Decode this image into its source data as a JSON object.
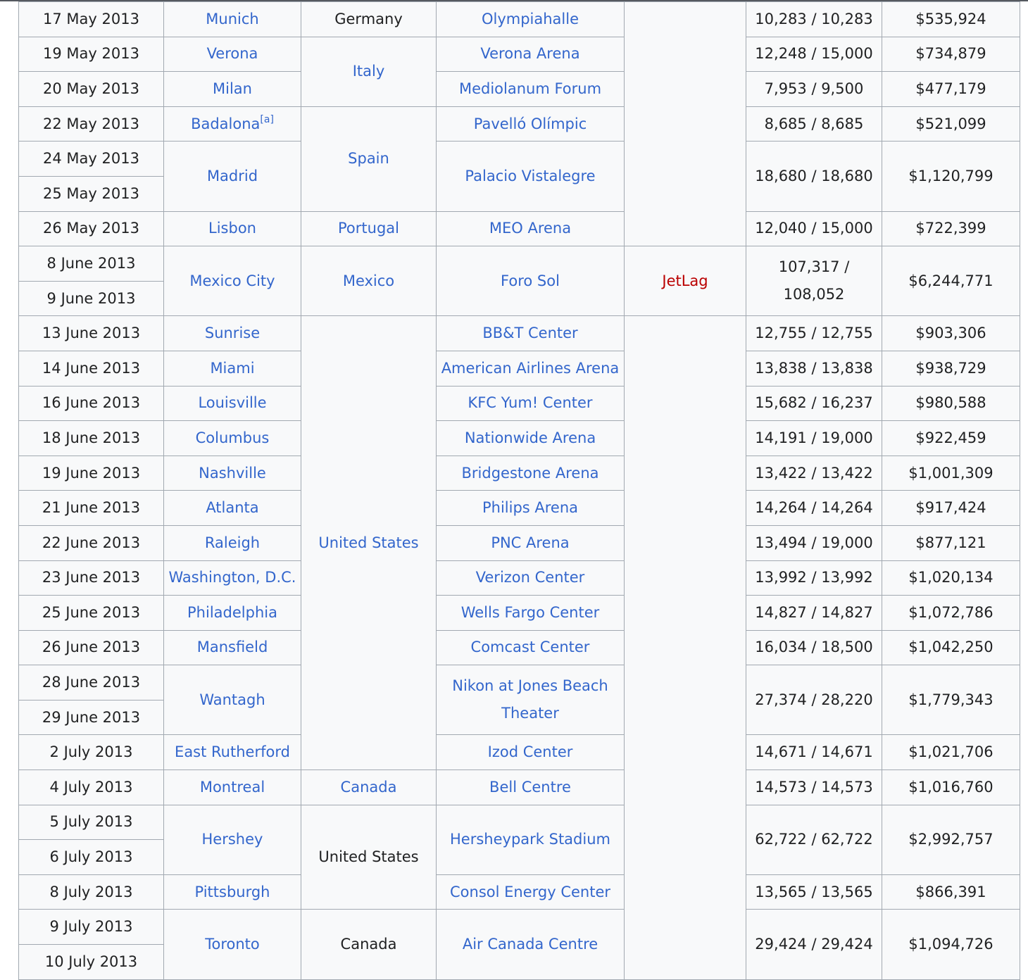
{
  "table": {
    "rows": [
      {
        "date": "17 May 2013",
        "city": "Munich",
        "country": "Germany",
        "venue": "Olympiahalle",
        "attendance": "10,283 / 10,283",
        "revenue": "$535,924"
      },
      {
        "date": "19 May 2013",
        "city": "Verona",
        "country": "Italy",
        "venue": "Verona Arena",
        "attendance": "12,248 / 15,000",
        "revenue": "$734,879"
      },
      {
        "date": "20 May 2013",
        "city": "Milan",
        "venue": "Mediolanum Forum",
        "attendance": "7,953 / 9,500",
        "revenue": "$477,179"
      },
      {
        "date": "22 May 2013",
        "city": "Badalona",
        "city_note": "[a]",
        "country": "Spain",
        "venue": "Pavelló Olímpic",
        "attendance": "8,685 / 8,685",
        "revenue": "$521,099"
      },
      {
        "date": "24 May 2013",
        "city": "Madrid",
        "venue": "Palacio Vistalegre",
        "attendance": "18,680 / 18,680",
        "revenue": "$1,120,799"
      },
      {
        "date": "25 May 2013"
      },
      {
        "date": "26 May 2013",
        "city": "Lisbon",
        "country": "Portugal",
        "venue": "MEO Arena",
        "attendance": "12,040 / 15,000",
        "revenue": "$722,399"
      },
      {
        "date": "8 June 2013",
        "city": "Mexico City",
        "country": "Mexico",
        "venue": "Foro Sol",
        "opening_act": "JetLag",
        "attendance": "107,317 / 108,052",
        "revenue": "$6,244,771"
      },
      {
        "date": "9 June 2013"
      },
      {
        "date": "13 June 2013",
        "city": "Sunrise",
        "country": "United States",
        "venue": "BB&T Center",
        "attendance": "12,755 / 12,755",
        "revenue": "$903,306"
      },
      {
        "date": "14 June 2013",
        "city": "Miami",
        "venue": "American Airlines Arena",
        "attendance": "13,838 / 13,838",
        "revenue": "$938,729"
      },
      {
        "date": "16 June 2013",
        "city": "Louisville",
        "venue": "KFC Yum! Center",
        "attendance": "15,682 / 16,237",
        "revenue": "$980,588"
      },
      {
        "date": "18 June 2013",
        "city": "Columbus",
        "venue": "Nationwide Arena",
        "attendance": "14,191 / 19,000",
        "revenue": "$922,459"
      },
      {
        "date": "19 June 2013",
        "city": "Nashville",
        "venue": "Bridgestone Arena",
        "attendance": "13,422 / 13,422",
        "revenue": "$1,001,309"
      },
      {
        "date": "21 June 2013",
        "city": "Atlanta",
        "venue": "Philips Arena",
        "attendance": "14,264 / 14,264",
        "revenue": "$917,424"
      },
      {
        "date": "22 June 2013",
        "city": "Raleigh",
        "venue": "PNC Arena",
        "attendance": "13,494 / 19,000",
        "revenue": "$877,121"
      },
      {
        "date": "23 June 2013",
        "city": "Washington, D.C.",
        "venue": "Verizon Center",
        "attendance": "13,992 / 13,992",
        "revenue": "$1,020,134"
      },
      {
        "date": "25 June 2013",
        "city": "Philadelphia",
        "venue": "Wells Fargo Center",
        "attendance": "14,827 / 14,827",
        "revenue": "$1,072,786"
      },
      {
        "date": "26 June 2013",
        "city": "Mansfield",
        "venue": "Comcast Center",
        "attendance": "16,034 / 18,500",
        "revenue": "$1,042,250"
      },
      {
        "date": "28 June 2013",
        "city": "Wantagh",
        "venue": "Nikon at Jones Beach Theater",
        "attendance": "27,374 / 28,220",
        "revenue": "$1,779,343"
      },
      {
        "date": "29 June 2013"
      },
      {
        "date": "2 July 2013",
        "city": "East Rutherford",
        "venue": "Izod Center",
        "attendance": "14,671 / 14,671",
        "revenue": "$1,021,706"
      },
      {
        "date": "4 July 2013",
        "city": "Montreal",
        "country": "Canada",
        "venue": "Bell Centre",
        "attendance": "14,573 / 14,573",
        "revenue": "$1,016,760"
      },
      {
        "date": "5 July 2013",
        "city": "Hershey",
        "country": "United States",
        "venue": "Hersheypark Stadium",
        "attendance": "62,722 / 62,722",
        "revenue": "$2,992,757"
      },
      {
        "date": "6 July 2013"
      },
      {
        "date": "8 July 2013",
        "city": "Pittsburgh",
        "venue": "Consol Energy Center",
        "attendance": "13,565 / 13,565",
        "revenue": "$866,391"
      },
      {
        "date": "9 July 2013",
        "city": "Toronto",
        "country": "Canada",
        "venue": "Air Canada Centre",
        "attendance": "29,424 / 29,424",
        "revenue": "$1,094,726"
      },
      {
        "date": "10 July 2013"
      }
    ]
  }
}
